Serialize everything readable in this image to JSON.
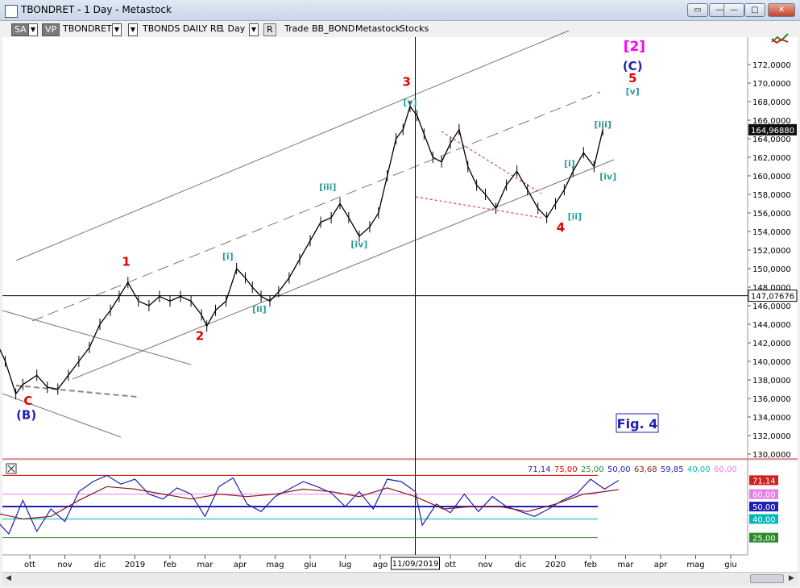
{
  "window": {
    "title": "TBONDRET - 1 Day - Metastock"
  },
  "toolbar": {
    "sa": "SA",
    "vp": "VP",
    "symbol": "TBONDRET",
    "name": "TBONDS DAILY RE",
    "period": "1 Day",
    "r": "R",
    "trade": "Trade",
    "template": "BB_BOND",
    "product": "Metastock",
    "stocks": "Stocks"
  },
  "chart_data": [
    {
      "type": "line",
      "title": "",
      "xlabel": "",
      "ylabel": "",
      "ylim": [
        130,
        173
      ],
      "y_ticks": [
        "130,0000",
        "132,0000",
        "134,0000",
        "136,0000",
        "138,0000",
        "140,0000",
        "142,0000",
        "144,0000",
        "146,0000",
        "148,0000",
        "150,0000",
        "152,0000",
        "154,0000",
        "156,0000",
        "158,0000",
        "160,0000",
        "162,0000",
        "164,0000",
        "166,0000",
        "168,0000",
        "170,0000",
        "172,0000"
      ],
      "y_tick_values": [
        130,
        132,
        134,
        136,
        138,
        140,
        142,
        144,
        146,
        148,
        150,
        152,
        154,
        156,
        158,
        160,
        162,
        164,
        166,
        168,
        170,
        172
      ],
      "x_ticks": [
        "ott",
        "nov",
        "dic",
        "2019",
        "feb",
        "mar",
        "apr",
        "mag",
        "giu",
        "lug",
        "ago",
        "ott",
        "nov",
        "dic",
        "2020",
        "feb",
        "mar",
        "apr",
        "mag",
        "giu"
      ],
      "x_tick_index": [
        1.0,
        2.0,
        3.0,
        4.0,
        5.0,
        6.0,
        7.0,
        8.0,
        9.0,
        10.0,
        11.0,
        13.0,
        14.0,
        15.0,
        16.0,
        17.0,
        18.0,
        19.0,
        20.0,
        21.0
      ],
      "cursor_date": "11/09/2019",
      "cursor_index": 12.0,
      "last_value": "164,96880",
      "last_value_num": 164.9688,
      "crosshair_value": "147,07676",
      "crosshair_value_num": 147.07676,
      "series": [
        {
          "x": [
            0.0,
            0.3,
            0.6,
            0.8,
            1.2,
            1.5,
            1.8,
            2.1,
            2.4,
            2.7,
            3.0,
            3.3,
            3.55,
            3.8,
            4.1,
            4.4,
            4.7,
            5.0,
            5.3,
            5.6,
            5.9,
            6.05,
            6.3,
            6.6,
            6.9,
            7.15,
            7.35,
            7.6,
            7.85,
            8.1,
            8.4,
            8.7,
            9.0,
            9.3,
            9.6,
            9.85,
            10.1,
            10.4,
            10.7,
            10.95,
            11.2,
            11.45,
            11.65,
            11.85,
            12.05,
            12.25,
            12.5,
            12.75,
            13.0,
            13.25,
            13.5,
            13.75,
            14.0,
            14.3,
            14.6,
            14.9,
            15.2,
            15.5,
            15.75,
            16.0,
            16.25,
            16.5,
            16.8,
            17.1,
            17.35
          ],
          "y": [
            142.5,
            140.0,
            136.5,
            137.5,
            138.5,
            137.2,
            137.0,
            138.5,
            140.0,
            141.5,
            144.0,
            145.5,
            147.0,
            148.5,
            146.5,
            146.0,
            147.0,
            146.5,
            147.0,
            146.5,
            145.0,
            143.8,
            145.5,
            146.5,
            150.0,
            149.0,
            148.0,
            147.0,
            146.5,
            147.5,
            149.0,
            151.0,
            153.0,
            155.0,
            155.5,
            157.0,
            155.5,
            153.5,
            154.5,
            156.0,
            160.0,
            164.0,
            165.0,
            167.5,
            166.5,
            164.5,
            162.0,
            161.5,
            163.5,
            165.0,
            161.0,
            159.0,
            158.0,
            156.5,
            159.0,
            160.5,
            158.5,
            156.5,
            155.5,
            157.0,
            158.5,
            160.5,
            162.5,
            161.0,
            164.97
          ]
        }
      ],
      "annotations": [
        {
          "text": "1",
          "color": "#e00000",
          "x": 3.75,
          "y": 150.3
        },
        {
          "text": "2",
          "color": "#e00000",
          "x": 5.85,
          "y": 142.3
        },
        {
          "text": "3",
          "color": "#e00000",
          "x": 11.75,
          "y": 169.7
        },
        {
          "text": "4",
          "color": "#e00000",
          "x": 16.15,
          "y": 154.0
        },
        {
          "text": "5",
          "color": "#e00000",
          "x": 18.2,
          "y": 170.1
        },
        {
          "text": "C",
          "color": "#e00000",
          "x": 0.95,
          "y": 135.3
        },
        {
          "text": "(B)",
          "color": "#1f1fb4",
          "x": 0.9,
          "y": 133.8
        },
        {
          "text": "(C)",
          "color": "#1f1fb4",
          "x": 18.2,
          "y": 171.4
        },
        {
          "text": "[2]",
          "color": "#ff00ff",
          "x": 18.25,
          "y": 173.5
        },
        {
          "text": "[i]",
          "color": "#2a9a9a",
          "x": 6.65,
          "y": 151.0
        },
        {
          "text": "[ii]",
          "color": "#2a9a9a",
          "x": 7.55,
          "y": 145.3
        },
        {
          "text": "[iii]",
          "color": "#2a9a9a",
          "x": 9.5,
          "y": 158.5
        },
        {
          "text": "[iv]",
          "color": "#2a9a9a",
          "x": 10.4,
          "y": 152.3
        },
        {
          "text": "[v]",
          "color": "#2a9a9a",
          "x": 11.85,
          "y": 167.6
        },
        {
          "text": "[i]",
          "color": "#2a9a9a",
          "x": 16.4,
          "y": 161.0
        },
        {
          "text": "[ii]",
          "color": "#2a9a9a",
          "x": 16.55,
          "y": 155.3
        },
        {
          "text": "[iii]",
          "color": "#2a9a9a",
          "x": 17.35,
          "y": 165.2
        },
        {
          "text": "[iv]",
          "color": "#2a9a9a",
          "x": 17.5,
          "y": 159.6
        },
        {
          "text": "[v]",
          "color": "#2a9a9a",
          "x": 18.2,
          "y": 168.8
        }
      ],
      "fig_label": "Fig. 4"
    },
    {
      "type": "line",
      "title": "",
      "ylim": [
        15,
        85
      ],
      "header_values": [
        {
          "text": "71,14",
          "color": "#1f1fb4"
        },
        {
          "text": "75,00",
          "color": "#e00000"
        },
        {
          "text": "25,00",
          "color": "#2a8a2a"
        },
        {
          "text": "50,00",
          "color": "#1f1fb4"
        },
        {
          "text": "63,68",
          "color": "#8b1a1a"
        },
        {
          "text": "59,85",
          "color": "#1f1fb4"
        },
        {
          "text": "40,00",
          "color": "#00b8b8"
        },
        {
          "text": "60,00",
          "color": "#e87ee8"
        }
      ],
      "levels": [
        {
          "value": 75,
          "label": "",
          "color": "#e00000"
        },
        {
          "value": 60,
          "label": "60,00",
          "color": "#e87ee8"
        },
        {
          "value": 50,
          "label": "50,00",
          "color": "#1f1fb4"
        },
        {
          "value": 40,
          "label": "40,00",
          "color": "#00b8b8"
        },
        {
          "value": 25,
          "label": "25,00",
          "color": "#2a8a2a"
        }
      ],
      "last_label": "71,14",
      "last_value": 71.14,
      "series": [
        {
          "name": "",
          "color": "#1f1fb4",
          "x": [
            0.0,
            0.4,
            0.8,
            1.2,
            1.6,
            2.0,
            2.4,
            2.8,
            3.2,
            3.6,
            4.0,
            4.4,
            4.8,
            5.2,
            5.6,
            6.0,
            6.4,
            6.8,
            7.2,
            7.6,
            8.0,
            8.4,
            8.8,
            9.2,
            9.6,
            10.0,
            10.4,
            10.8,
            11.2,
            11.6,
            12.0,
            12.2,
            12.6,
            13.0,
            13.4,
            13.8,
            14.2,
            14.6,
            15.0,
            15.4,
            15.8,
            16.2,
            16.6,
            17.0,
            17.4,
            17.8
          ],
          "y": [
            40,
            28,
            55,
            30,
            48,
            38,
            62,
            70,
            75,
            68,
            72,
            60,
            56,
            65,
            60,
            42,
            66,
            73,
            52,
            46,
            58,
            64,
            70,
            66,
            61,
            50,
            62,
            48,
            72,
            70,
            62,
            35,
            52,
            45,
            60,
            46,
            58,
            50,
            46,
            42,
            48,
            55,
            60,
            72,
            64,
            71
          ]
        },
        {
          "name": "",
          "color": "#8b1a1a",
          "x": [
            0.0,
            0.8,
            1.6,
            2.4,
            3.2,
            4.0,
            4.8,
            5.6,
            6.4,
            7.2,
            8.0,
            8.8,
            9.6,
            10.4,
            11.2,
            12.0,
            12.8,
            13.6,
            14.4,
            15.2,
            16.0,
            16.8,
            17.4,
            17.8
          ],
          "y": [
            45,
            40,
            42,
            55,
            66,
            64,
            60,
            56,
            60,
            58,
            60,
            64,
            62,
            58,
            65,
            58,
            48,
            50,
            50,
            46,
            52,
            60,
            62,
            63.7
          ]
        }
      ]
    }
  ]
}
